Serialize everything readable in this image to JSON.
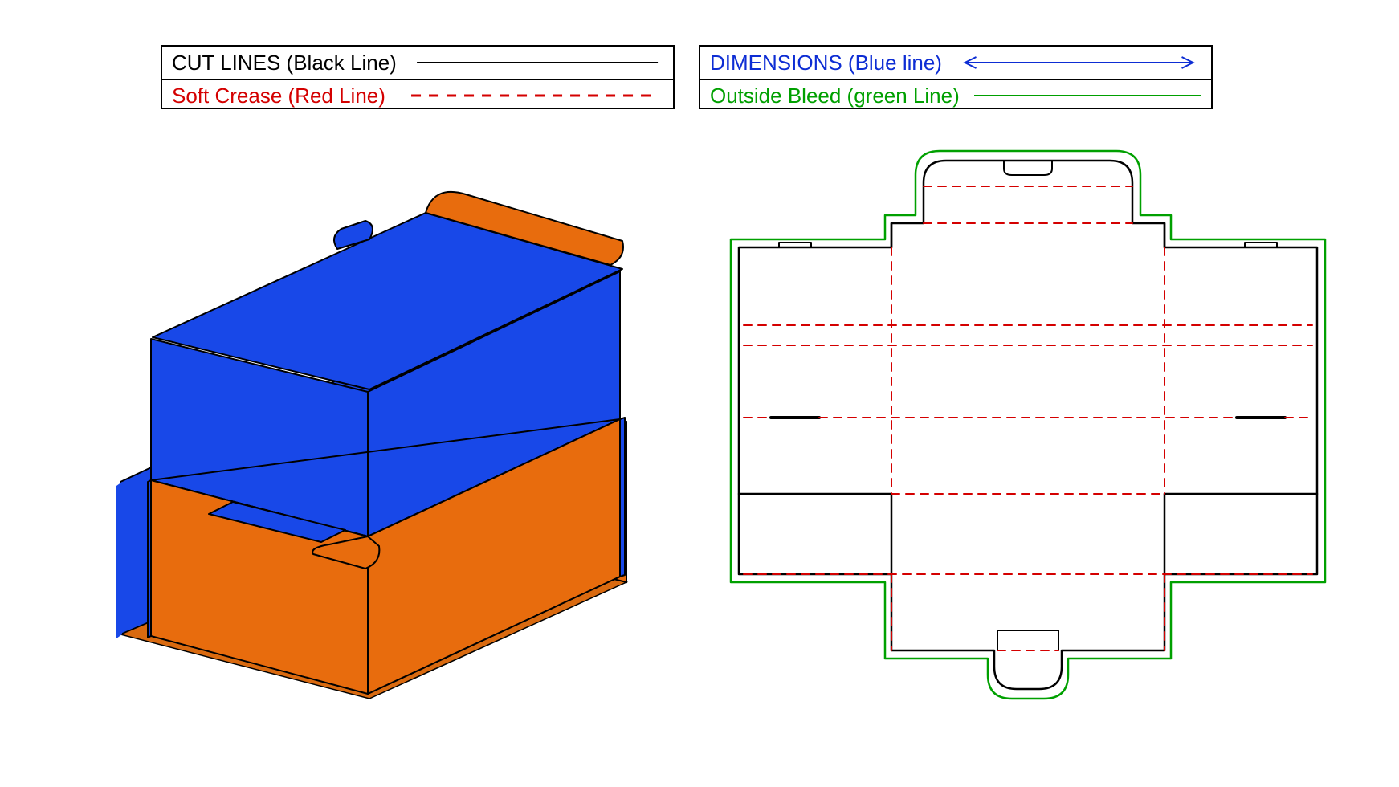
{
  "legend": {
    "left": {
      "row1": {
        "label": "CUT LINES (Black Line)",
        "color": "#000000",
        "style": "solid"
      },
      "row2": {
        "label": "Soft Crease (Red Line)",
        "color": "#d40000",
        "style": "dashed"
      }
    },
    "right": {
      "row1": {
        "label": "DIMENSIONS (Blue line)",
        "color": "#0d2dd4",
        "style": "arrow"
      },
      "row2": {
        "label": "Outside Bleed (green Line)",
        "color": "#00a000",
        "style": "solid"
      }
    }
  },
  "box3d": {
    "outer_color": "#e86c0d",
    "inner_color": "#1848e8",
    "outline_color": "#000000"
  },
  "dieline": {
    "cut_color": "#000000",
    "crease_color": "#d40000",
    "bleed_color": "#00a000"
  }
}
